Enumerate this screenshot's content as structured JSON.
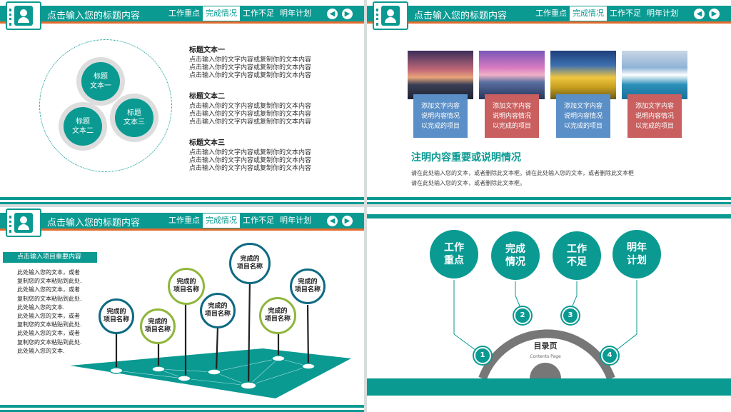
{
  "header": {
    "title": "点击输入您的标题内容",
    "tabs": [
      "工作重点",
      "完成情况",
      "工作不足",
      "明年计划"
    ],
    "active_tab": 1,
    "prev_icon": "chevron-left-icon",
    "next_icon": "chevron-right-icon"
  },
  "colors": {
    "primary": "#0a9a92",
    "accent": "#e36b2e",
    "blue": "#5b8fc7",
    "red": "#c95f5f",
    "dark_blue": "#0e6a82",
    "green": "#8fb63c"
  },
  "slide1": {
    "circles": [
      "标题\n文本一",
      "标题\n文本二",
      "标题\n文本三"
    ],
    "blocks": [
      {
        "title": "标题文本一",
        "lines": [
          "点击输入你的文字内容或复制你的文本内容",
          "点击输入你的文字内容或复制你的文本内容",
          "点击输入你的文字内容或复制你的文本内容"
        ]
      },
      {
        "title": "标题文本二",
        "lines": [
          "点击输入你的文字内容或复制你的文本内容",
          "点击输入你的文字内容或复制你的文本内容",
          "点击输入你的文字内容或复制你的文本内容"
        ]
      },
      {
        "title": "标题文本三",
        "lines": [
          "点击输入你的文字内容或复制你的文本内容",
          "点击输入你的文字内容或复制你的文本内容",
          "点击输入你的文字内容或复制你的文本内容"
        ]
      }
    ]
  },
  "slide2": {
    "captions": [
      "添加文字内容\n说明内容情况\n以完成的项目",
      "添加文字内容\n说明内容情况\n以完成的项目",
      "添加文字内容\n说明内容情况\n以完成的项目",
      "添加文字内容\n说明内容情况\n以完成的项目"
    ],
    "heading": "注明内容重要或说明情况",
    "text1": "请在此处输入您的文本，或者删除此文本框。请在此处输入您的文本，或者删除此文本框",
    "text2": "请在此处输入您的文本，或者删除此文本框。"
  },
  "slide3": {
    "sidebar_heading": "点击输入项目重要内容",
    "sidebar_text": "此处输入您的文本，或者\n复制您的文本粘贴到此处.\n此处输入您的文本，或者\n复制您的文本粘贴到此处.\n此处输入您的文本.\n此处输入您的文本，或者\n复制您的文本粘贴到此处.\n此处输入您的文本，或者\n复制您的文本粘贴到此处.\n此处输入您的文本.",
    "nodes": [
      "完成的\n项目名称",
      "完成的\n项目名称",
      "完成的\n项目名称",
      "完成的\n项目名称",
      "完成的\n项目名称",
      "完成的\n项目名称",
      "完成的\n项目名称"
    ]
  },
  "slide4": {
    "items": [
      "工作\n重点",
      "完成\n情况",
      "工作\n不足",
      "明年\n计划"
    ],
    "numbers": [
      "1",
      "2",
      "3",
      "4"
    ],
    "center_title": "目录页",
    "center_sub": "Contents  Page"
  }
}
